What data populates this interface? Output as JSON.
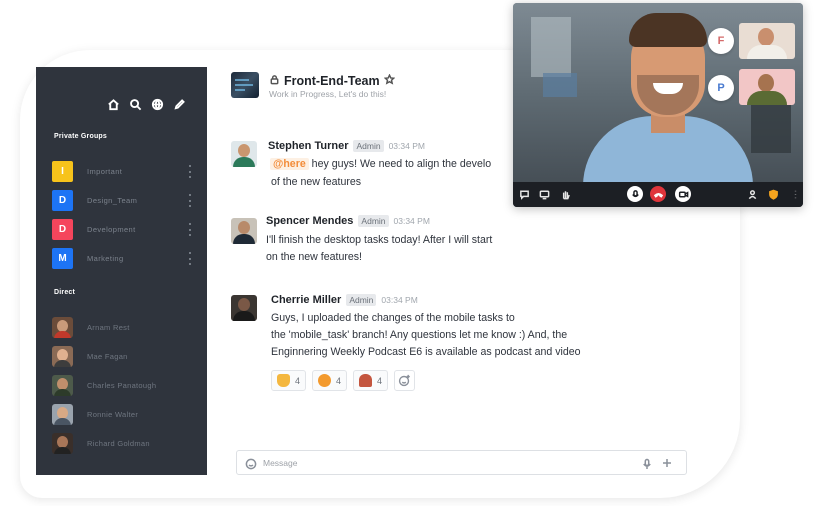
{
  "colors": {
    "sidebar_bg": "#2f343d",
    "mention": "#f38c39",
    "hangup": "#e0353b",
    "badge_I": "#f7c31b",
    "badge_D": "#1d74f5",
    "badge_D2": "#f5455c",
    "badge_M": "#1d74f5"
  },
  "sidebar": {
    "toolbar_icons": [
      "home-icon",
      "search-icon",
      "globe-icon",
      "pencil-icon"
    ],
    "private_groups_title": "Private Groups",
    "groups": [
      {
        "badge": "I",
        "label": "Important",
        "color": "#f7c31b"
      },
      {
        "badge": "D",
        "label": "Design_Team",
        "color": "#1d74f5"
      },
      {
        "badge": "D",
        "label": "Development",
        "color": "#f5455c"
      },
      {
        "badge": "M",
        "label": "Marketing",
        "color": "#1d74f5"
      }
    ],
    "direct_title": "Direct",
    "direct": [
      {
        "label": "Arnam Rest"
      },
      {
        "label": "Mae Fagan"
      },
      {
        "label": "Charles Panatough"
      },
      {
        "label": "Ronnie Walter"
      },
      {
        "label": "Richard Goldman"
      }
    ]
  },
  "header": {
    "room_name": "Front-End-Team",
    "topic": "Work in Progress, Let's do this!"
  },
  "messages": [
    {
      "author": "Stephen Turner",
      "role": "Admin",
      "time": "03:34 PM",
      "mention": "@here",
      "line1": "hey guys! We need to align the develo",
      "line2": "of the new features"
    },
    {
      "author": "Spencer Mendes",
      "role": "Admin",
      "time": "03:34 PM",
      "line1": "I'll finish the desktop tasks today! After I will start",
      "line2": "on the new features!"
    },
    {
      "author": "Cherrie Miller",
      "role": "Admin",
      "time": "03:34 PM",
      "line1": "Guys, I uploaded the changes of the mobile tasks to",
      "line2": "the 'mobile_task' branch! Any questions let me know :) And, the",
      "line3": "Enginnering Weekly Podcast E6 is available as podcast and video"
    }
  ],
  "reactions": [
    {
      "icon": "thumbs-up-icon",
      "count": "4",
      "color": "#f4b73f"
    },
    {
      "icon": "heart-eyes-icon",
      "count": "4",
      "color": "#f39a2e"
    },
    {
      "icon": "person-emoji-icon",
      "count": "4",
      "color": "#c4563f"
    }
  ],
  "composer": {
    "placeholder": "Message"
  },
  "video_call": {
    "participants": [
      {
        "initial": "F"
      },
      {
        "initial": "P"
      }
    ]
  }
}
